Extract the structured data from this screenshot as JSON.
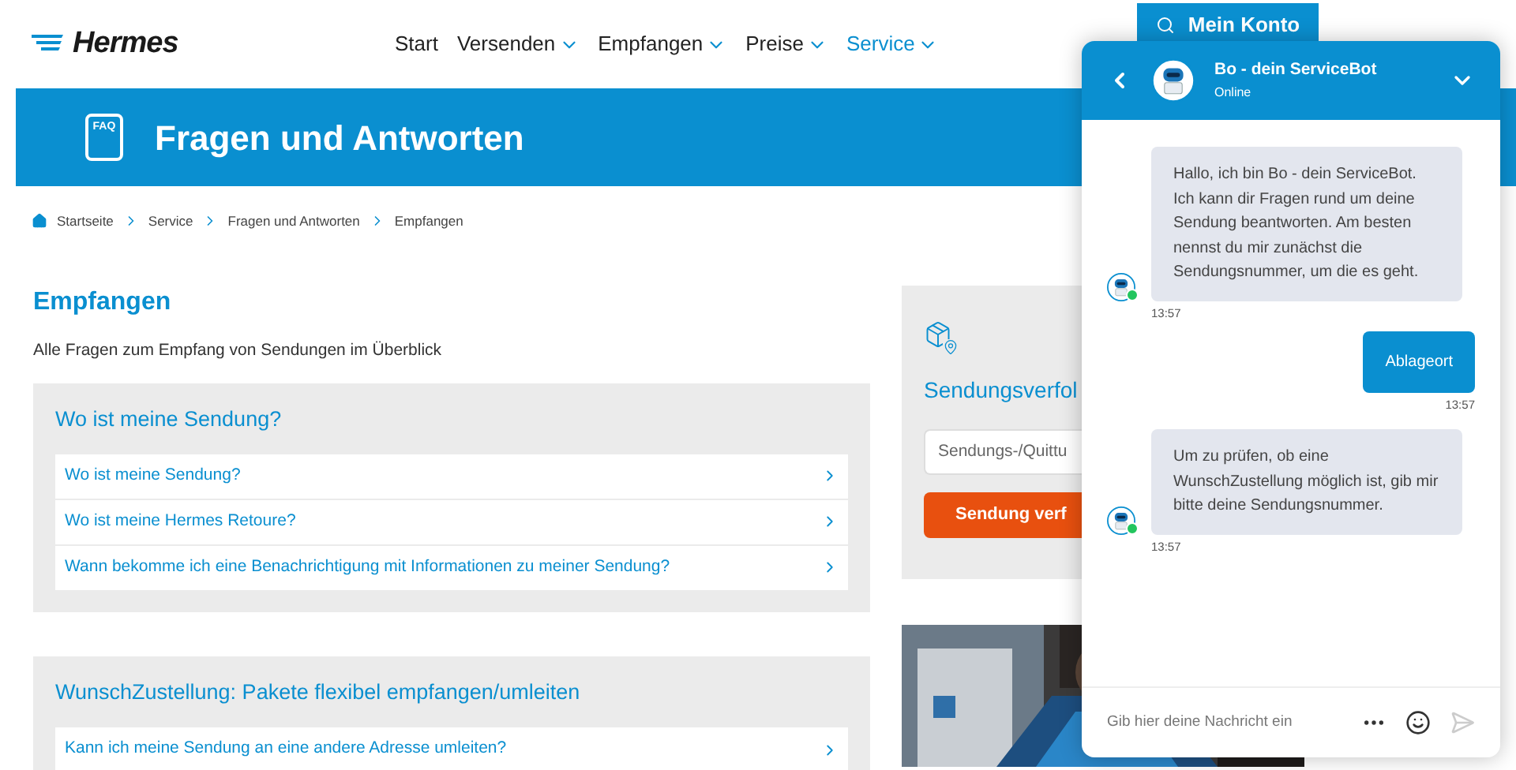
{
  "header": {
    "logo": "Hermes",
    "nav": [
      {
        "label": "Start",
        "dropdown": false,
        "selected": false
      },
      {
        "label": "Versenden",
        "dropdown": true,
        "selected": false
      },
      {
        "label": "Empfangen",
        "dropdown": true,
        "selected": false
      },
      {
        "label": "Preise",
        "dropdown": true,
        "selected": false
      },
      {
        "label": "Service",
        "dropdown": true,
        "selected": true
      }
    ],
    "account_button": "Mein Konto"
  },
  "banner": {
    "icon_text": "FAQ",
    "title": "Fragen und Antworten"
  },
  "breadcrumb": [
    "Startseite",
    "Service",
    "Fragen und Antworten",
    "Empfangen"
  ],
  "page": {
    "title": "Empfangen",
    "subtitle": "Alle Fragen zum Empfang von Sendungen im Überblick"
  },
  "faq_sections": [
    {
      "title": "Wo ist meine Sendung?",
      "questions": [
        "Wo ist meine Sendung?",
        "Wo ist meine Hermes Retoure?",
        "Wann bekomme ich eine Benachrichtigung mit Informationen zu meiner Sendung?"
      ]
    },
    {
      "title": "WunschZustellung: Pakete flexibel empfangen/umleiten",
      "questions": [
        "Kann ich meine Sendung an eine andere Adresse umleiten?"
      ]
    }
  ],
  "tracking": {
    "title": "Sendungsverfol",
    "placeholder": "Sendungs-/Quittu",
    "button": "Sendung verf"
  },
  "promo": {
    "kind": "picture"
  },
  "chat": {
    "bot_name": "Bo - dein ServiceBot",
    "status": "Online",
    "messages": [
      {
        "kind": "bot",
        "text": "Hallo, ich bin Bo - dein ServiceBot. Ich kann dir Fragen rund um deine Sendung beantworten. Am besten nennst du mir zunächst die Sendungsnummer, um die es geht.",
        "time": "13:57"
      },
      {
        "kind": "user",
        "text": "Ablageort",
        "time": "13:57"
      },
      {
        "kind": "bot",
        "text": "Um zu prüfen, ob eine WunschZustellung möglich ist, gib mir bitte deine Sendungsnummer.",
        "time": "13:57"
      }
    ],
    "input_placeholder": "Gib hier deine Nachricht ein"
  }
}
